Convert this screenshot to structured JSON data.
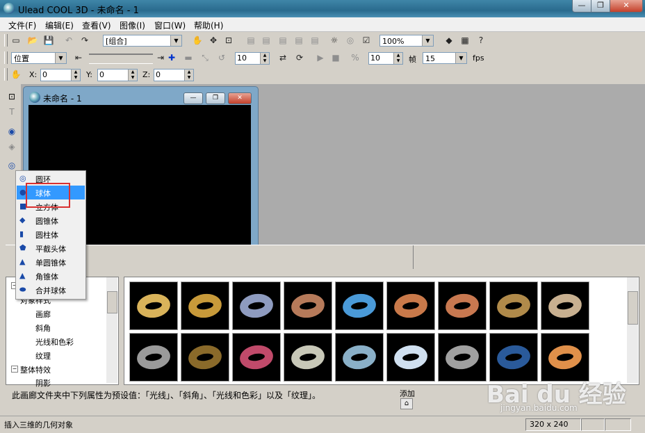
{
  "window": {
    "title": "Ulead COOL 3D - 未命名 - 1",
    "min": "—",
    "max": "❐",
    "close": "✕"
  },
  "menu": [
    "文件(F)",
    "编辑(E)",
    "查看(V)",
    "图像(I)",
    "窗口(W)",
    "帮助(H)"
  ],
  "toolbar1": {
    "group_select": "[组合]",
    "zoom": "100%"
  },
  "toolbar2": {
    "position_select": "位置",
    "value1": "10",
    "value2": "10",
    "frames_label": "帧",
    "frames_value": "15",
    "fps_label": "fps"
  },
  "toolbar3": {
    "x_label": "X:",
    "x_value": "0",
    "y_label": "Y:",
    "y_value": "0",
    "z_label": "Z:",
    "z_value": "0"
  },
  "document": {
    "title": "未命名 - 1",
    "size": "320 x 240"
  },
  "popup_menu": {
    "items": [
      {
        "label": "圆环",
        "icon": "torus-icon"
      },
      {
        "label": "球体",
        "icon": "sphere-icon",
        "highlighted": true
      },
      {
        "label": "立方体",
        "icon": "cube-icon"
      },
      {
        "label": "圆锥体",
        "icon": "cone-icon"
      },
      {
        "label": "圆柱体",
        "icon": "cylinder-icon"
      },
      {
        "label": "平截头体",
        "icon": "frustum-icon"
      },
      {
        "label": "单圆锥体",
        "icon": "single-cone-icon"
      },
      {
        "label": "角锥体",
        "icon": "pyramid-icon"
      },
      {
        "label": "合并球体",
        "icon": "merged-sphere-icon"
      }
    ]
  },
  "tree": {
    "nodes": [
      {
        "label": "对象样式"
      },
      {
        "label": "画廊"
      },
      {
        "label": "斜角"
      },
      {
        "label": "光线和色彩"
      },
      {
        "label": "纹理"
      },
      {
        "label": "整体特效"
      },
      {
        "label": "阴影"
      }
    ]
  },
  "gallery": {
    "thumb_colors": [
      "#d9b35a",
      "#c89a3a",
      "#8e9bbf",
      "#b67a5a",
      "#4a9ad8",
      "#c9794a",
      "#c87850",
      "#b08a4a",
      "#c8b090",
      "#9a9a9a",
      "#8a6a2a",
      "#c04a6a",
      "#c8c8b8",
      "#8ab0c8",
      "#d0e0f0",
      "#a0a0a0",
      "#2a5a9a",
      "#e0904a"
    ]
  },
  "info": {
    "text": "此画廊文件夹中下列属性为预设值：「光线」、「斜角」、「光线和色彩」以及「纹理」。",
    "add": "添加"
  },
  "status": {
    "message": "插入三维的几何对象",
    "size": "320 x 240"
  },
  "watermark": {
    "brand": "Bai du 经验",
    "url": "jingyan.baidu.com"
  }
}
